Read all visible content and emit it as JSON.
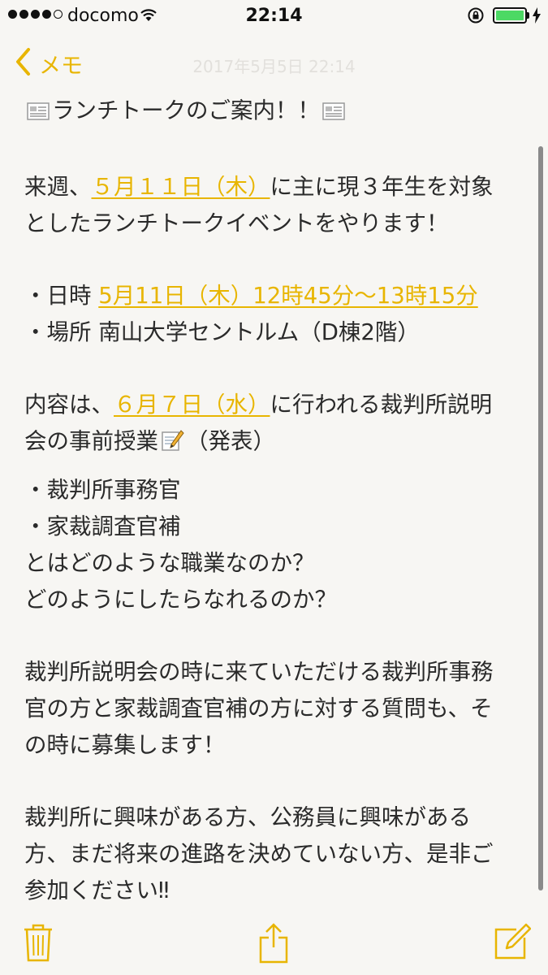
{
  "status_bar": {
    "carrier": "docomo",
    "time": "22:14",
    "battery_percent": 100,
    "signal_bars_filled": 4,
    "signal_bars_total": 5
  },
  "nav": {
    "back_label": "メモ",
    "date_label": "2017年5月5日 22:14"
  },
  "note": {
    "title": "ランチトークのご案内！！",
    "p1_prefix": "来週、",
    "p1_date": "５月１１日（木）",
    "p1_suffix": "に主に現３年生を対象",
    "p1_line2": "としたランチトークイベントをやります！",
    "datetime_label": "・日時 ",
    "datetime_value": "5月11日（木）12時45分〜13時15分",
    "place": "・場所 南山大学セントルム（D棟2階）",
    "p3_prefix": "内容は、",
    "p3_date": "６月７日（水）",
    "p3_suffix": "に行われる裁判所説明",
    "p3_line2_a": "会の事前授業",
    "p3_line2_b": "（発表）",
    "item1": "・裁判所事務官",
    "item2": "・家裁調査官補",
    "q1": "とはどのような職業なのか？",
    "q2": "どのようにしたらなれるのか？",
    "p5_l1": "裁判所説明会の時に来ていただける裁判所事務",
    "p5_l2": "官の方と家裁調査官補の方に対する質問も、そ",
    "p5_l3": "の時に募集します！",
    "p6_l1": "裁判所に興味がある方、公務員に興味がある",
    "p6_l2": "方、まだ将来の進路を決めていない方、是非ご",
    "p6_l3": "参加ください‼︎"
  },
  "colors": {
    "accent": "#e8b500",
    "background": "#f7f6f3",
    "text": "#2a2a2a"
  },
  "icons": [
    "newspaper-icon",
    "memo-icon",
    "trash-icon",
    "share-icon",
    "compose-icon"
  ]
}
